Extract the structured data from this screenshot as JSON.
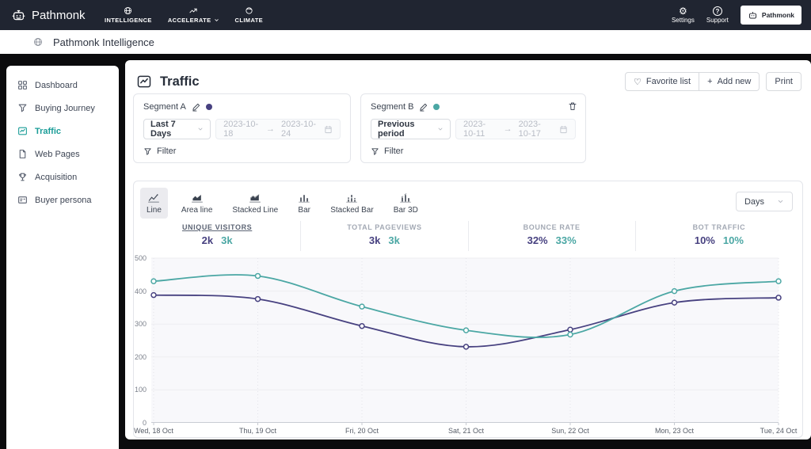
{
  "theme": {
    "topnav_bg": "#202531",
    "accent_teal": "#1b9d98",
    "page_bg": "#0b0b0d",
    "series_a_color": "#474180",
    "series_b_color": "#4ba7a4"
  },
  "topnav": {
    "brand": "Pathmonk",
    "items": [
      {
        "label": "INTELLIGENCE"
      },
      {
        "label": "ACCELERATE"
      },
      {
        "label": "CLIMATE"
      }
    ],
    "settings_label": "Settings",
    "support_label": "Support",
    "account_label": "Pathmonk"
  },
  "subheader": {
    "title": "Pathmonk Intelligence"
  },
  "sidebar": {
    "items": [
      {
        "label": "Dashboard"
      },
      {
        "label": "Buying Journey"
      },
      {
        "label": "Traffic"
      },
      {
        "label": "Web Pages"
      },
      {
        "label": "Acquisition"
      },
      {
        "label": "Buyer persona"
      }
    ]
  },
  "page": {
    "title": "Traffic",
    "favorite_label": "Favorite list",
    "add_new_label": "Add new",
    "print_label": "Print"
  },
  "segments": [
    {
      "name": "Segment A",
      "color": "#474180",
      "preset": "Last 7 Days",
      "date_from": "2023-10-18",
      "date_to": "2023-10-24",
      "filter_label": "Filter"
    },
    {
      "name": "Segment B",
      "color": "#4ba7a4",
      "preset": "Previous period",
      "date_from": "2023-10-11",
      "date_to": "2023-10-17",
      "filter_label": "Filter"
    }
  ],
  "chart_controls": {
    "types": [
      {
        "label": "Line"
      },
      {
        "label": "Area line"
      },
      {
        "label": "Stacked Line"
      },
      {
        "label": "Bar"
      },
      {
        "label": "Stacked Bar"
      },
      {
        "label": "Bar 3D"
      }
    ],
    "selected": "Line",
    "interval": "Days"
  },
  "metrics": [
    {
      "label": "UNIQUE VISITORS",
      "segment_a": "2k",
      "segment_b": "3k"
    },
    {
      "label": "TOTAL PAGEVIEWS",
      "segment_a": "3k",
      "segment_b": "3k"
    },
    {
      "label": "BOUNCE RATE",
      "segment_a": "32%",
      "segment_b": "33%"
    },
    {
      "label": "BOT TRAFFIC",
      "segment_a": "10%",
      "segment_b": "10%"
    }
  ],
  "chart_data": {
    "type": "line",
    "x": [
      "Wed, 18 Oct",
      "Thu, 19 Oct",
      "Fri, 20 Oct",
      "Sat, 21 Oct",
      "Sun, 22 Oct",
      "Mon, 23 Oct",
      "Tue, 24 Oct"
    ],
    "series": [
      {
        "name": "Segment A",
        "color": "#474180",
        "values": [
          388,
          376,
          294,
          231,
          283,
          365,
          380
        ]
      },
      {
        "name": "Segment B",
        "color": "#4ba7a4",
        "values": [
          430,
          446,
          353,
          281,
          268,
          400,
          430
        ]
      }
    ],
    "ylim": [
      0,
      500
    ],
    "yticks": [
      0,
      100,
      200,
      300,
      400,
      500
    ],
    "grid": "horizontal solid, vertical dotted",
    "legend": "none"
  },
  "glyphs": {
    "date_arrow": "→",
    "heart": "♡",
    "plus": "+",
    "gear": "⚙"
  }
}
